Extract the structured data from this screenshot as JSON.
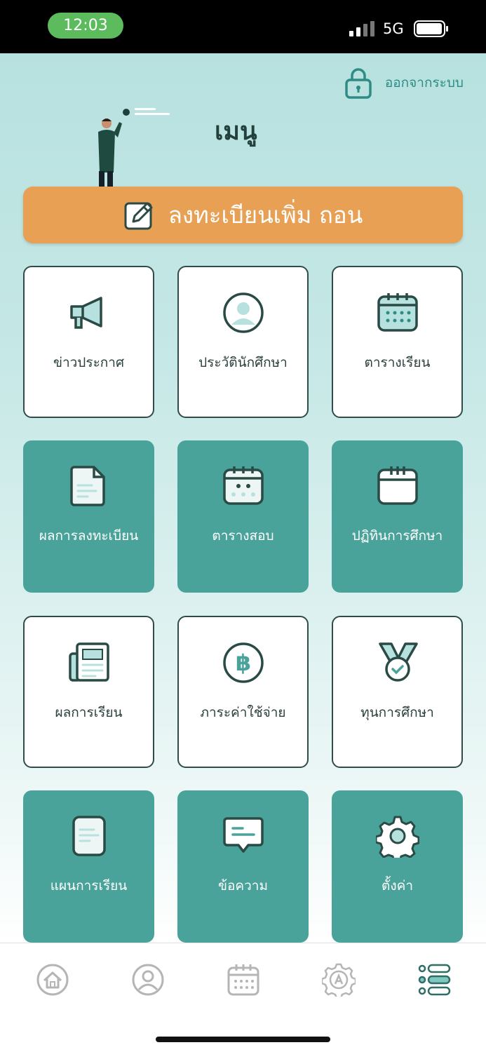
{
  "status_bar": {
    "time": "12:03",
    "network": "5G"
  },
  "header": {
    "logout_label": "ออกจากระบบ",
    "title": "เมนู"
  },
  "register_button": {
    "label": "ลงทะเบียนเพิ่ม ถอน"
  },
  "menu": {
    "items": [
      {
        "label": "ข่าวประกาศ",
        "icon": "megaphone-icon"
      },
      {
        "label": "ประวัตินักศึกษา",
        "icon": "user-circle-icon"
      },
      {
        "label": "ตารางเรียน",
        "icon": "calendar-icon"
      },
      {
        "label": "ผลการลงทะเบียน",
        "icon": "document-icon"
      },
      {
        "label": "ตารางสอบ",
        "icon": "exam-calendar-icon"
      },
      {
        "label": "ปฏิทินการศึกษา",
        "icon": "academic-calendar-icon"
      },
      {
        "label": "ผลการเรียน",
        "icon": "newspaper-icon"
      },
      {
        "label": "ภาระค่าใช้จ่าย",
        "icon": "baht-coin-icon"
      },
      {
        "label": "ทุนการศึกษา",
        "icon": "medal-icon"
      },
      {
        "label": "แผนการเรียน",
        "icon": "study-plan-icon"
      },
      {
        "label": "ข้อความ",
        "icon": "message-icon"
      },
      {
        "label": "ตั้งค่า",
        "icon": "gear-icon"
      }
    ]
  },
  "bottom_nav": {
    "items": [
      {
        "icon": "home-icon"
      },
      {
        "icon": "profile-icon"
      },
      {
        "icon": "calendar-icon"
      },
      {
        "icon": "grade-badge-icon"
      },
      {
        "icon": "menu-list-icon",
        "active": true
      }
    ]
  },
  "colors": {
    "accent": "#4aa39a",
    "register": "#e8a055",
    "title": "#23413c",
    "status_pill": "#5cbb5c",
    "nav_inactive": "#b5b5b5",
    "nav_active": "#2f6e67"
  }
}
